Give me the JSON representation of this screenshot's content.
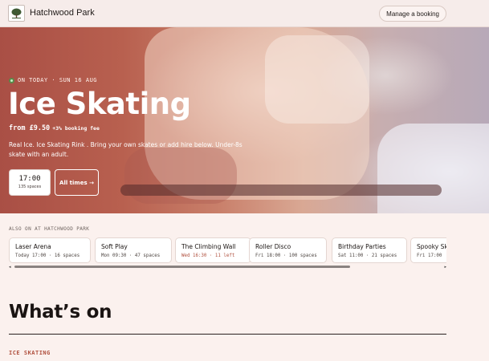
{
  "header": {
    "site_name": "Hatchwood Park",
    "manage_label": "Manage a booking"
  },
  "hero": {
    "badge": "ON TODAY · SUN 16 AUG",
    "title": "Ice Skating",
    "price": "from £9.50",
    "fee": "+3% booking fee",
    "description": "Real Ice. Ice Skating Rink . Bring your own skates or add hire below. Under-8s skate with an adult.",
    "time_slot": {
      "time": "17:00",
      "spaces": "135 spaces"
    },
    "all_times_label": "All times →"
  },
  "also_on": {
    "label": "ALSO ON AT HATCHWOOD PARK",
    "items": [
      {
        "name": "Laser Arena",
        "detail": "Today 17:00 · 16 spaces",
        "low": false
      },
      {
        "name": "Soft Play",
        "detail": "Mon 09:30 · 47 spaces",
        "low": false
      },
      {
        "name": "The Climbing Wall",
        "detail": "Wed 16:30 · 11 left",
        "low": true
      },
      {
        "name": "Roller Disco",
        "detail": "Fri 18:00 · 100 spaces",
        "low": false
      },
      {
        "name": "Birthday Parties",
        "detail": "Sat 11:00 · 21 spaces",
        "low": false
      },
      {
        "name": "Spooky Sk",
        "detail": "Fri 17:00",
        "low": false
      }
    ]
  },
  "whats_on": {
    "heading": "What’s on",
    "section_label": "ICE SKATING"
  }
}
